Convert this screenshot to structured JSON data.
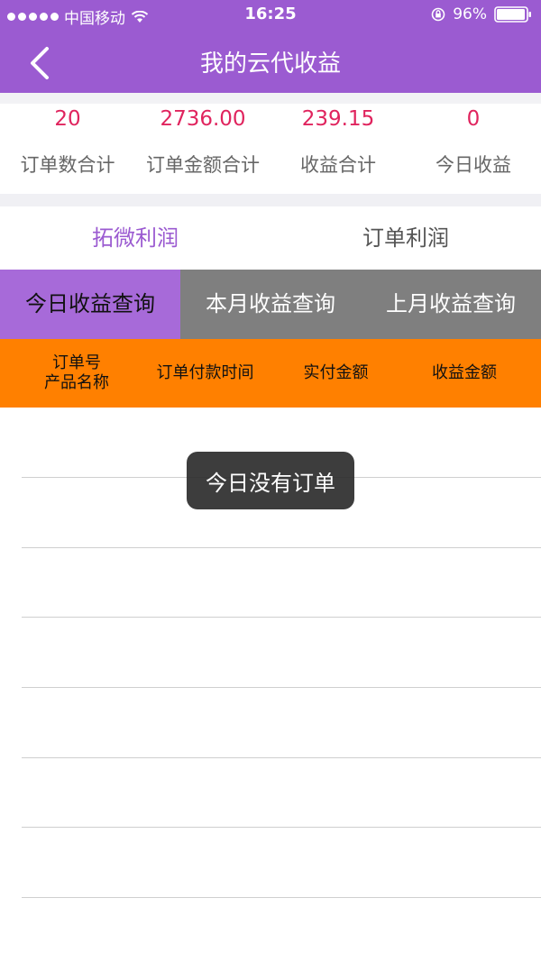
{
  "status_bar": {
    "carrier": "中国移动",
    "time": "16:25",
    "battery": "96%"
  },
  "header": {
    "title": "我的云代收益",
    "back_icon": "chevron-left-icon"
  },
  "summary": [
    {
      "value": "20",
      "label": "订单数合计"
    },
    {
      "value": "2736.00",
      "label": "订单金额合计"
    },
    {
      "value": "239.15",
      "label": "收益合计"
    },
    {
      "value": "0",
      "label": "今日收益"
    }
  ],
  "profit_tabs": [
    {
      "label": "拓微利润",
      "active": true
    },
    {
      "label": "订单利润",
      "active": false
    }
  ],
  "period_tabs": [
    {
      "label": "今日收益查询",
      "active": true
    },
    {
      "label": "本月收益查询",
      "active": false
    },
    {
      "label": "上月收益查询",
      "active": false
    }
  ],
  "table": {
    "columns": [
      {
        "line1": "订单号",
        "line2": "产品名称"
      },
      {
        "line1": "订单付款时间",
        "line2": ""
      },
      {
        "line1": "实付金额",
        "line2": ""
      },
      {
        "line1": "收益金额",
        "line2": ""
      }
    ],
    "rows": []
  },
  "toast": {
    "message": "今日没有订单"
  },
  "colors": {
    "header_bg": "#9b5bd1",
    "accent_value": "#e0245e",
    "active_tab": "#9b5bd1",
    "period_active_bg": "#a76ad9",
    "period_bg": "#7f7f7f",
    "table_header_bg": "#ff8000"
  }
}
